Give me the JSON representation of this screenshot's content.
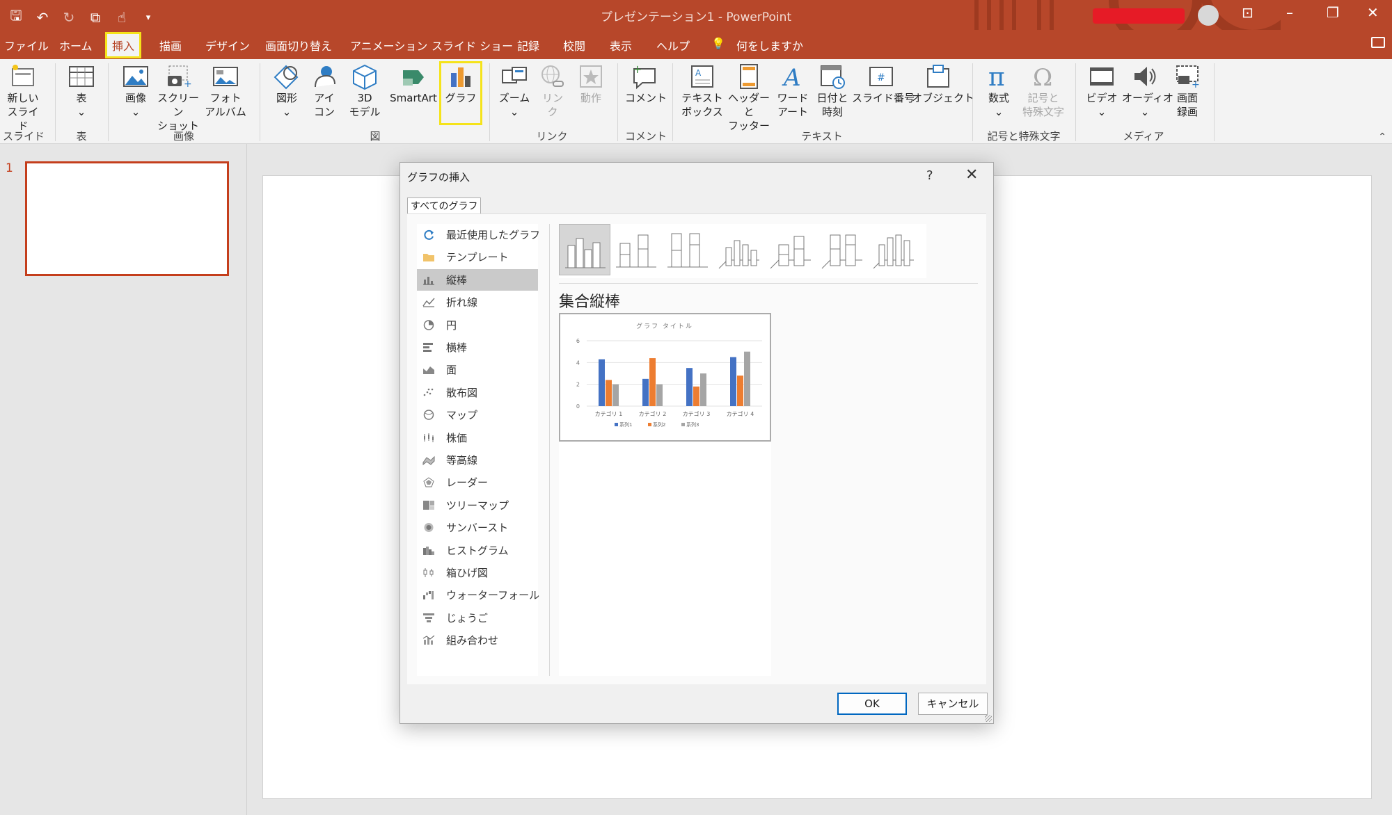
{
  "window": {
    "title": "プレゼンテーション1  -  PowerPoint",
    "accent_color": "#b7472a"
  },
  "menu": {
    "tabs": [
      "ファイル",
      "ホーム",
      "挿入",
      "描画",
      "デザイン",
      "画面切り替え",
      "アニメーション",
      "スライド ショー",
      "記録",
      "校閲",
      "表示",
      "ヘルプ"
    ],
    "active_tab": "挿入",
    "tell_me": "何をしますか"
  },
  "ribbon": {
    "new_slide": "新しい\nスライド",
    "table": "表",
    "image": "画像",
    "screenshot": "スクリーン\nショット",
    "photo_album": "フォト\nアルバム",
    "shapes": "図形",
    "icons": "アイ\nコン",
    "model3d": "3D\nモデル",
    "smartart": "SmartArt",
    "chart": "グラフ",
    "zoom": "ズーム",
    "link": "リン\nク",
    "action": "動作",
    "comment": "コメント",
    "textbox": "テキスト\nボックス",
    "header_footer": "ヘッダーと\nフッター",
    "wordart": "ワード\nアート",
    "datetime": "日付と\n時刻",
    "slide_number": "スライド番号",
    "object": "オブジェクト",
    "equation": "数式",
    "symbol": "記号と\n特殊文字",
    "video": "ビデオ",
    "audio": "オーディオ",
    "screen_recording": "画面\n録画",
    "groups": {
      "slides": "スライド",
      "tables": "表",
      "images": "画像",
      "illustrations": "図",
      "links": "リンク",
      "comments": "コメント",
      "text": "テキスト",
      "symbols": "記号と特殊文字",
      "media": "メディア"
    }
  },
  "thumbnails": {
    "slide_number": "1"
  },
  "dialog": {
    "title": "グラフの挿入",
    "help": "?",
    "close": "✕",
    "tab": "すべてのグラフ",
    "chart_types": [
      {
        "label": "最近使用したグラフ",
        "icon": "recent-icon"
      },
      {
        "label": "テンプレート",
        "icon": "folder-icon"
      },
      {
        "label": "縦棒",
        "icon": "column-chart-icon"
      },
      {
        "label": "折れ線",
        "icon": "line-chart-icon"
      },
      {
        "label": "円",
        "icon": "pie-chart-icon"
      },
      {
        "label": "横棒",
        "icon": "bar-chart-icon"
      },
      {
        "label": "面",
        "icon": "area-chart-icon"
      },
      {
        "label": "散布図",
        "icon": "scatter-chart-icon"
      },
      {
        "label": "マップ",
        "icon": "map-chart-icon"
      },
      {
        "label": "株価",
        "icon": "stock-chart-icon"
      },
      {
        "label": "等高線",
        "icon": "surface-chart-icon"
      },
      {
        "label": "レーダー",
        "icon": "radar-chart-icon"
      },
      {
        "label": "ツリーマップ",
        "icon": "treemap-chart-icon"
      },
      {
        "label": "サンバースト",
        "icon": "sunburst-chart-icon"
      },
      {
        "label": "ヒストグラム",
        "icon": "histogram-chart-icon"
      },
      {
        "label": "箱ひげ図",
        "icon": "boxwhisker-chart-icon"
      },
      {
        "label": "ウォーターフォール",
        "icon": "waterfall-chart-icon"
      },
      {
        "label": "じょうご",
        "icon": "funnel-chart-icon"
      },
      {
        "label": "組み合わせ",
        "icon": "combo-chart-icon"
      }
    ],
    "selected_type_index": 2,
    "selected_subtype_name": "集合縦棒",
    "ok": "OK",
    "cancel": "キャンセル"
  },
  "chart_data": {
    "type": "bar",
    "title": "グラフ タイトル",
    "categories": [
      "カテゴリ 1",
      "カテゴリ 2",
      "カテゴリ 3",
      "カテゴリ 4"
    ],
    "series": [
      {
        "name": "系列1",
        "values": [
          4.3,
          2.5,
          3.5,
          4.5
        ],
        "color": "#4472c4"
      },
      {
        "name": "系列2",
        "values": [
          2.4,
          4.4,
          1.8,
          2.8
        ],
        "color": "#ed7d31"
      },
      {
        "name": "系列3",
        "values": [
          2,
          2,
          3,
          5
        ],
        "color": "#a5a5a5"
      }
    ],
    "ylim": [
      0,
      6
    ],
    "yticks": [
      "0",
      "2",
      "4",
      "6"
    ],
    "grid": true,
    "legend": "bottom"
  }
}
